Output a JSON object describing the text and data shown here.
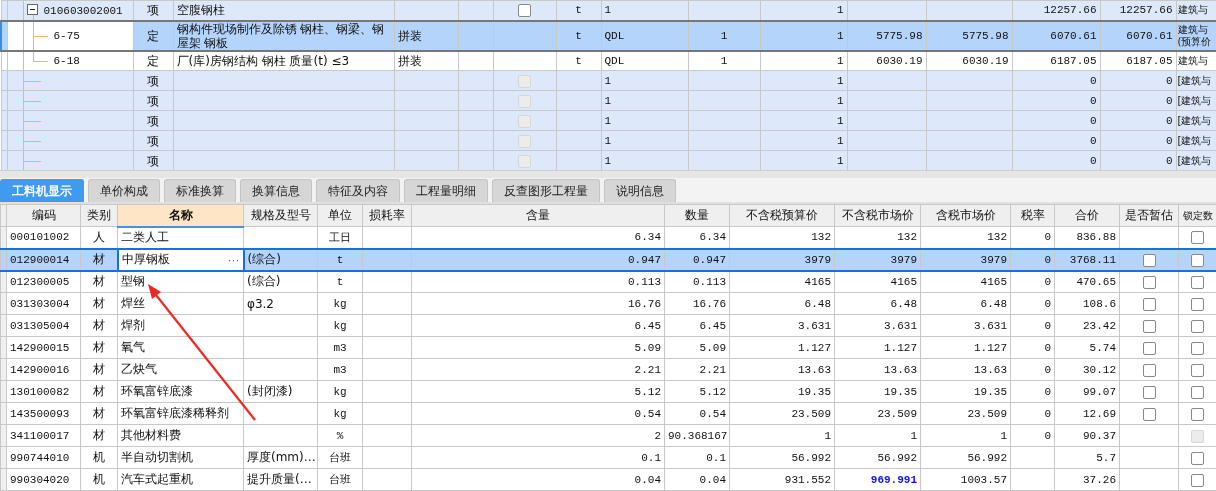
{
  "top_grid": {
    "rows": [
      {
        "kind": "bill",
        "code": "010603002001",
        "type": "项",
        "name": "空腹钢柱",
        "expanded": true,
        "selected": false,
        "checkbox": {
          "checked": false,
          "disabled": false
        },
        "cells": [
          null,
          null,
          "t",
          "1",
          null,
          "1",
          null,
          null,
          "12257.66",
          "12257.66",
          "建筑与"
        ],
        "children": [
          {
            "kind": "quota",
            "code": "6-75",
            "type": "定",
            "name": "钢构件现场制作及除锈 钢柱、钢梁、钢屋架 钢板",
            "selected": true,
            "cells": [
              "拼装",
              null,
              "t",
              "QDL",
              "1",
              "1",
              "5775.98",
              "5775.98",
              "6070.61",
              "6070.61",
              "建筑与\n(预算价"
            ]
          },
          {
            "kind": "quota",
            "code": "6-18",
            "type": "定",
            "name": "厂(库)房钢结构 钢柱 质量(t) ≤3",
            "selected": false,
            "cells": [
              "拼装",
              null,
              "t",
              "QDL",
              "1",
              "1",
              "6030.19",
              "6030.19",
              "6187.05",
              "6187.05",
              "建筑与"
            ]
          }
        ]
      },
      {
        "kind": "bill",
        "type": "项",
        "selected": false,
        "checkbox": {
          "checked": false,
          "disabled": true
        },
        "cells": [
          null,
          null,
          null,
          "1",
          null,
          "1",
          null,
          null,
          "0",
          "0",
          "[建筑与"
        ]
      },
      {
        "kind": "bill",
        "type": "项",
        "selected": false,
        "checkbox": {
          "checked": false,
          "disabled": true
        },
        "cells": [
          null,
          null,
          null,
          "1",
          null,
          "1",
          null,
          null,
          "0",
          "0",
          "[建筑与"
        ]
      },
      {
        "kind": "bill",
        "type": "项",
        "selected": false,
        "checkbox": {
          "checked": false,
          "disabled": true
        },
        "cells": [
          null,
          null,
          null,
          "1",
          null,
          "1",
          null,
          null,
          "0",
          "0",
          "[建筑与"
        ]
      },
      {
        "kind": "bill",
        "type": "项",
        "selected": false,
        "checkbox": {
          "checked": false,
          "disabled": true
        },
        "cells": [
          null,
          null,
          null,
          "1",
          null,
          "1",
          null,
          null,
          "0",
          "0",
          "[建筑与"
        ]
      },
      {
        "kind": "bill",
        "type": "项",
        "selected": false,
        "checkbox": {
          "checked": false,
          "disabled": true
        },
        "cells": [
          null,
          null,
          null,
          "1",
          null,
          "1",
          null,
          null,
          "0",
          "0",
          "[建筑与"
        ]
      }
    ]
  },
  "tabs": [
    {
      "label": "工料机显示",
      "selected": true
    },
    {
      "label": "单价构成",
      "selected": false
    },
    {
      "label": "标准换算",
      "selected": false
    },
    {
      "label": "换算信息",
      "selected": false
    },
    {
      "label": "特征及内容",
      "selected": false
    },
    {
      "label": "工程量明细",
      "selected": false
    },
    {
      "label": "反查图形工程量",
      "selected": false
    },
    {
      "label": "说明信息",
      "selected": false
    }
  ],
  "bottom_grid": {
    "columns": [
      {
        "label": "编码",
        "selected": false
      },
      {
        "label": "类别",
        "selected": false
      },
      {
        "label": "名称",
        "selected": true
      },
      {
        "label": "规格及型号",
        "selected": false
      },
      {
        "label": "单位",
        "selected": false
      },
      {
        "label": "损耗率",
        "selected": false
      },
      {
        "label": "含量",
        "selected": false
      },
      {
        "label": "数量",
        "selected": false
      },
      {
        "label": "不含税预算价",
        "selected": false
      },
      {
        "label": "不含税市场价",
        "selected": false
      },
      {
        "label": "含税市场价",
        "selected": false
      },
      {
        "label": "税率",
        "selected": false
      },
      {
        "label": "合价",
        "selected": false
      },
      {
        "label": "是否暂估",
        "selected": false
      },
      {
        "label": "锁定数",
        "selected": false
      }
    ],
    "rows": [
      {
        "code": "000101002",
        "category": "人",
        "name": "二类人工",
        "unit": "工日",
        "content": "6.34",
        "quantity": "6.34",
        "budget_price": "132",
        "market_price": "132",
        "market_changed": false,
        "tax_market_price": "132",
        "tax_rate": "0",
        "total": "836.88",
        "lock": {
          "checked": false,
          "disabled": false
        },
        "selected": false
      },
      {
        "code": "012900014",
        "category": "材",
        "name": "中厚钢板",
        "name_button": "···",
        "spec": "(综合)",
        "unit": "t",
        "content": "0.947",
        "quantity": "0.947",
        "budget_price": "3979",
        "market_price": "3979",
        "market_changed": false,
        "tax_market_price": "3979",
        "tax_rate": "0",
        "total": "3768.11",
        "estimate": {
          "checked": false
        },
        "lock": {
          "checked": false,
          "disabled": false
        },
        "selected": true
      },
      {
        "code": "012300005",
        "category": "材",
        "name": "型钢",
        "spec": "(综合)",
        "unit": "t",
        "content": "0.113",
        "quantity": "0.113",
        "budget_price": "4165",
        "market_price": "4165",
        "market_changed": false,
        "tax_market_price": "4165",
        "tax_rate": "0",
        "total": "470.65",
        "estimate": {
          "checked": false
        },
        "lock": {
          "checked": false,
          "disabled": false
        },
        "selected": false
      },
      {
        "code": "031303004",
        "category": "材",
        "name": "焊丝",
        "spec": "φ3.2",
        "unit": "kg",
        "content": "16.76",
        "quantity": "16.76",
        "budget_price": "6.48",
        "market_price": "6.48",
        "market_changed": false,
        "tax_market_price": "6.48",
        "tax_rate": "0",
        "total": "108.6",
        "estimate": {
          "checked": false
        },
        "lock": {
          "checked": false,
          "disabled": false
        },
        "selected": false
      },
      {
        "code": "031305004",
        "category": "材",
        "name": "焊剂",
        "unit": "kg",
        "content": "6.45",
        "quantity": "6.45",
        "budget_price": "3.631",
        "market_price": "3.631",
        "market_changed": false,
        "tax_market_price": "3.631",
        "tax_rate": "0",
        "total": "23.42",
        "estimate": {
          "checked": false
        },
        "lock": {
          "checked": false,
          "disabled": false
        },
        "selected": false
      },
      {
        "code": "142900015",
        "category": "材",
        "name": "氧气",
        "unit": "m3",
        "content": "5.09",
        "quantity": "5.09",
        "budget_price": "1.127",
        "market_price": "1.127",
        "market_changed": false,
        "tax_market_price": "1.127",
        "tax_rate": "0",
        "total": "5.74",
        "estimate": {
          "checked": false
        },
        "lock": {
          "checked": false,
          "disabled": false
        },
        "selected": false
      },
      {
        "code": "142900016",
        "category": "材",
        "name": "乙炔气",
        "unit": "m3",
        "content": "2.21",
        "quantity": "2.21",
        "budget_price": "13.63",
        "market_price": "13.63",
        "market_changed": false,
        "tax_market_price": "13.63",
        "tax_rate": "0",
        "total": "30.12",
        "estimate": {
          "checked": false
        },
        "lock": {
          "checked": false,
          "disabled": false
        },
        "selected": false
      },
      {
        "code": "130100082",
        "category": "材",
        "name": "环氧富锌底漆",
        "spec": "(封闭漆)",
        "unit": "kg",
        "content": "5.12",
        "quantity": "5.12",
        "budget_price": "19.35",
        "market_price": "19.35",
        "market_changed": false,
        "tax_market_price": "19.35",
        "tax_rate": "0",
        "total": "99.07",
        "estimate": {
          "checked": false
        },
        "lock": {
          "checked": false,
          "disabled": false
        },
        "selected": false
      },
      {
        "code": "143500093",
        "category": "材",
        "name": "环氧富锌底漆稀释剂",
        "unit": "kg",
        "content": "0.54",
        "quantity": "0.54",
        "budget_price": "23.509",
        "market_price": "23.509",
        "market_changed": false,
        "tax_market_price": "23.509",
        "tax_rate": "0",
        "total": "12.69",
        "estimate": {
          "checked": false
        },
        "lock": {
          "checked": false,
          "disabled": false
        },
        "selected": false
      },
      {
        "code": "341100017",
        "category": "材",
        "name": "其他材料费",
        "unit": "%",
        "content": "2",
        "quantity": "90.368167",
        "budget_price": "1",
        "market_price": "1",
        "market_changed": false,
        "tax_market_price": "1",
        "tax_rate": "0",
        "total": "90.37",
        "lock": {
          "checked": false,
          "disabled": true
        },
        "selected": false
      },
      {
        "code": "990744010",
        "category": "机",
        "name": "半自动切割机",
        "spec": "厚度(mm)…",
        "unit": "台班",
        "content": "0.1",
        "quantity": "0.1",
        "budget_price": "56.992",
        "market_price": "56.992",
        "market_changed": false,
        "tax_market_price": "56.992",
        "total": "5.7",
        "lock": {
          "checked": false,
          "disabled": false
        },
        "selected": false
      },
      {
        "code": "990304020",
        "category": "机",
        "name": "汽车式起重机",
        "spec": "提升质量(…",
        "unit": "台班",
        "content": "0.04",
        "quantity": "0.04",
        "budget_price": "931.552",
        "market_price": "969.991",
        "market_changed": true,
        "tax_market_price": "1003.57",
        "total": "37.26",
        "lock": {
          "checked": false,
          "disabled": false
        },
        "selected": false
      }
    ]
  }
}
